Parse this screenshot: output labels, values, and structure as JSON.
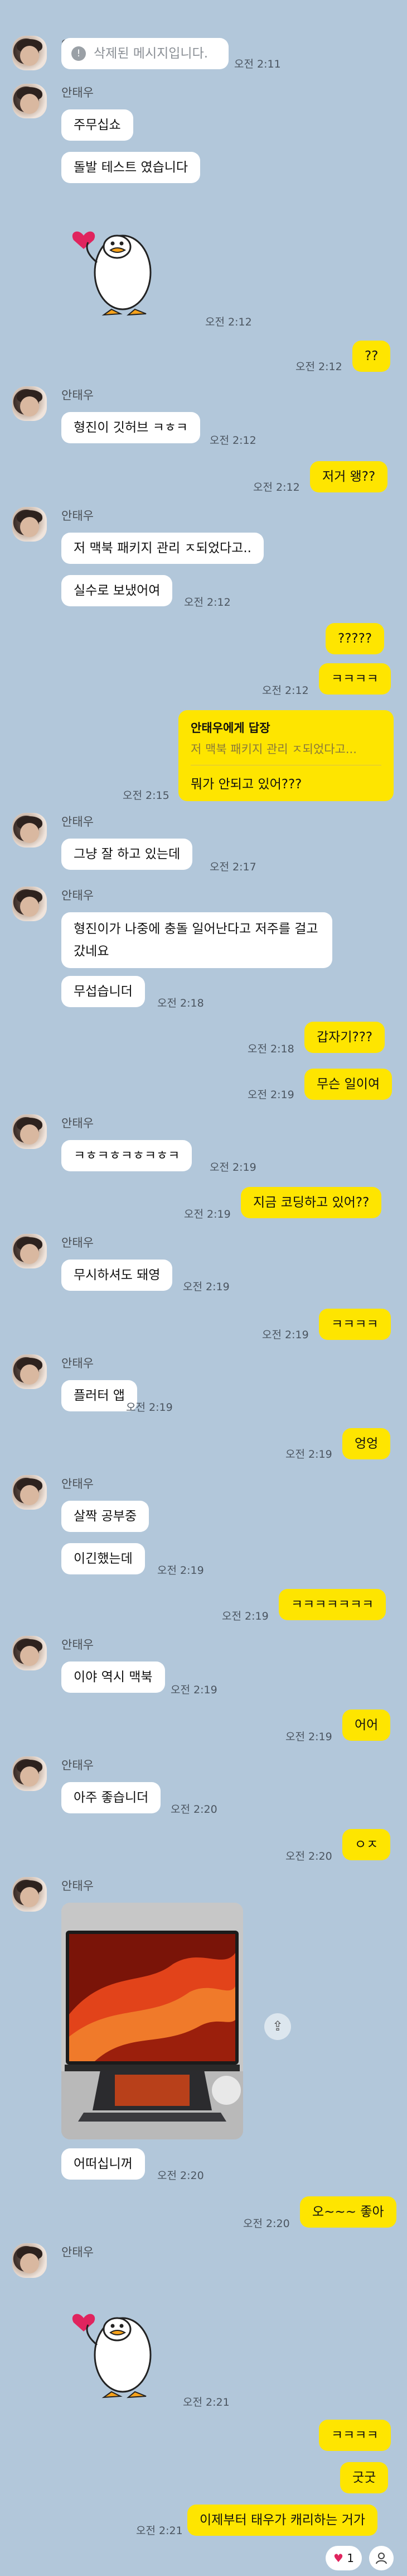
{
  "colors": {
    "background": "#b2c7da",
    "incoming": "#ffffff",
    "outgoing": "#fee500",
    "reaction_heart": "#e0245e"
  },
  "sender_name": "안태우",
  "messages": {
    "m1": {
      "text": "삭제된 메시지입니다.",
      "time": "오전 2:11"
    },
    "m2": {
      "text": "주무십쇼"
    },
    "m3": {
      "text": "돌발 테스트 였습니다"
    },
    "m4": {
      "time": "오전 2:12",
      "sticker": "duck-heart-sticker"
    },
    "m5": {
      "text": "??",
      "time": "오전 2:12"
    },
    "m6": {
      "text": "형진이 깃허브 ㅋㅎㅋ",
      "time": "오전 2:12"
    },
    "m7": {
      "text": "저거 왱??",
      "time": "오전 2:12"
    },
    "m8": {
      "text": "저 맥북 패키지 관리 ㅈ되었다고.."
    },
    "m9": {
      "text": "실수로 보냈어여",
      "time": "오전 2:12"
    },
    "m10": {
      "text": "?????"
    },
    "m11": {
      "text": "ㅋㅋㅋㅋ",
      "time": "오전 2:12"
    },
    "m12": {
      "reply_title": "안태우에게 답장",
      "reply_quote": "저 맥북 패키지 관리 ㅈ되었다고...",
      "text": "뭐가 안되고 있어???",
      "time": "오전 2:15"
    },
    "m13": {
      "text": "그냥 잘 하고 있는데",
      "time": "오전 2:17"
    },
    "m14": {
      "text": "형진이가 나중에 충돌 일어난다고 저주를 걸고 갔네요"
    },
    "m15": {
      "text": "무섭습니더",
      "time": "오전 2:18"
    },
    "m16": {
      "text": "갑자기???",
      "time": "오전 2:18"
    },
    "m17": {
      "text": "무슨 일이여",
      "time": "오전 2:19"
    },
    "m18": {
      "text": "ㅋㅎㅋㅎㅋㅎㅋㅎㅋ",
      "time": "오전 2:19"
    },
    "m19": {
      "text": "지금 코딩하고 있어??",
      "time": "오전 2:19"
    },
    "m20": {
      "text": "무시하셔도 돼영",
      "time": "오전 2:19"
    },
    "m21": {
      "text": "ㅋㅋㅋㅋ",
      "time": "오전 2:19"
    },
    "m22": {
      "text": "플러터 앱",
      "time": "오전 2:19"
    },
    "m23": {
      "text": "엉엉",
      "time": "오전 2:19"
    },
    "m24": {
      "text": "살짝 공부중"
    },
    "m25": {
      "text": "이긴했는데",
      "time": "오전 2:19"
    },
    "m26": {
      "text": "ㅋㅋㅋㅋㅋㅋㅋ",
      "time": "오전 2:19"
    },
    "m27": {
      "text": "이야 역시 맥북",
      "time": "오전 2:19"
    },
    "m28": {
      "text": "어어",
      "time": "오전 2:19"
    },
    "m29": {
      "text": "아주 좋습니더",
      "time": "오전 2:20"
    },
    "m30": {
      "text": "ㅇㅈ",
      "time": "오전 2:20"
    },
    "m31": {
      "photo": "macbook-photo"
    },
    "m32": {
      "text": "어떠십니꺼",
      "time": "오전 2:20"
    },
    "m33": {
      "text": "오~~~ 좋아",
      "time": "오전 2:20"
    },
    "m34": {
      "time": "오전 2:21",
      "sticker": "duck-heart-sticker"
    },
    "m35": {
      "text": "ㅋㅋㅋㅋ"
    },
    "m36": {
      "text": "굿굿"
    },
    "m37": {
      "text": "이제부터 태우가 캐리하는 거가",
      "time": "오전 2:21"
    }
  },
  "reaction": {
    "icon": "heart-icon",
    "count": "1"
  }
}
